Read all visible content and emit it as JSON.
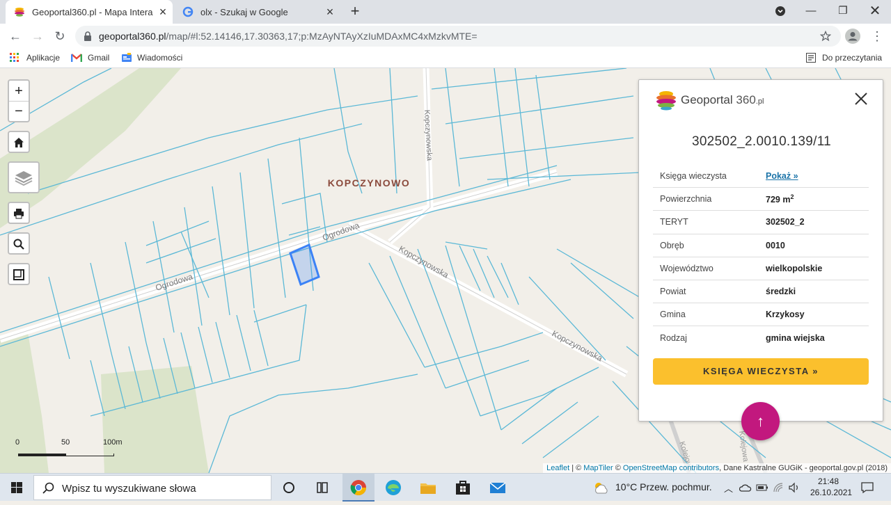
{
  "browser": {
    "tabs": [
      {
        "title": "Geoportal360.pl - Mapa Interaktywna",
        "favicon": "geoportal-logo-icon",
        "active": true
      },
      {
        "title": "olx - Szukaj w Google",
        "favicon": "google-icon",
        "active": false
      }
    ],
    "url_host": "geoportal360.pl",
    "url_path": "/map/#l:52.14146,17.30363,17;p:MzAyNTAyXzIuMDAxMC4xMzkvMTE="
  },
  "bookmarks": {
    "items": [
      "Aplikacje",
      "Gmail",
      "Wiadomości"
    ],
    "reading_list": "Do przeczytania"
  },
  "map": {
    "place_label": "KOPCZYNOWO",
    "street_labels": [
      "Ogrodowa",
      "Ogrodowa",
      "Kopczynowska",
      "Kopczynowska",
      "Kopczynowska",
      "Kolejowa",
      "Kolejowa"
    ],
    "scale": {
      "tick0": "0",
      "tick1": "50",
      "tick2": "100m"
    },
    "attribution": {
      "leaflet": "Leaflet",
      "sep": " | © ",
      "maptiler": "MapTiler",
      "sep2": " © ",
      "osm": "OpenStreetMap contributors",
      "rest": ", Dane Kastralne GUGiK - geoportal.gov.pl (2018)"
    },
    "highlight_color": "#3b82f6",
    "parcel_line_color": "#5bb8d6"
  },
  "panel": {
    "logo_name": "Geoportal",
    "logo_num": "360",
    "logo_tld": ".pl",
    "parcel_id": "302502_2.0010.139/11",
    "rows": [
      {
        "key": "Księga wieczysta",
        "value": "Pokaż »"
      },
      {
        "key": "Powierzchnia",
        "value": "729 m",
        "sup": "2"
      },
      {
        "key": "TERYT",
        "value": "302502_2"
      },
      {
        "key": "Obręb",
        "value": "0010"
      },
      {
        "key": "Województwo",
        "value": "wielkopolskie"
      },
      {
        "key": "Powiat",
        "value": "średzki"
      },
      {
        "key": "Gmina",
        "value": "Krzykosy"
      },
      {
        "key": "Rodzaj",
        "value": "gmina wiejska"
      }
    ],
    "button_label": "KSIĘGA WIECZYSTA »",
    "accent": "#fbc02d",
    "fab_label": "↑",
    "fab_color": "#c2187e"
  },
  "taskbar": {
    "search_placeholder": "Wpisz tu wyszukiwane słowa",
    "weather": "10°C  Przew. pochmur.",
    "time": "21:48",
    "date": "26.10.2021"
  }
}
